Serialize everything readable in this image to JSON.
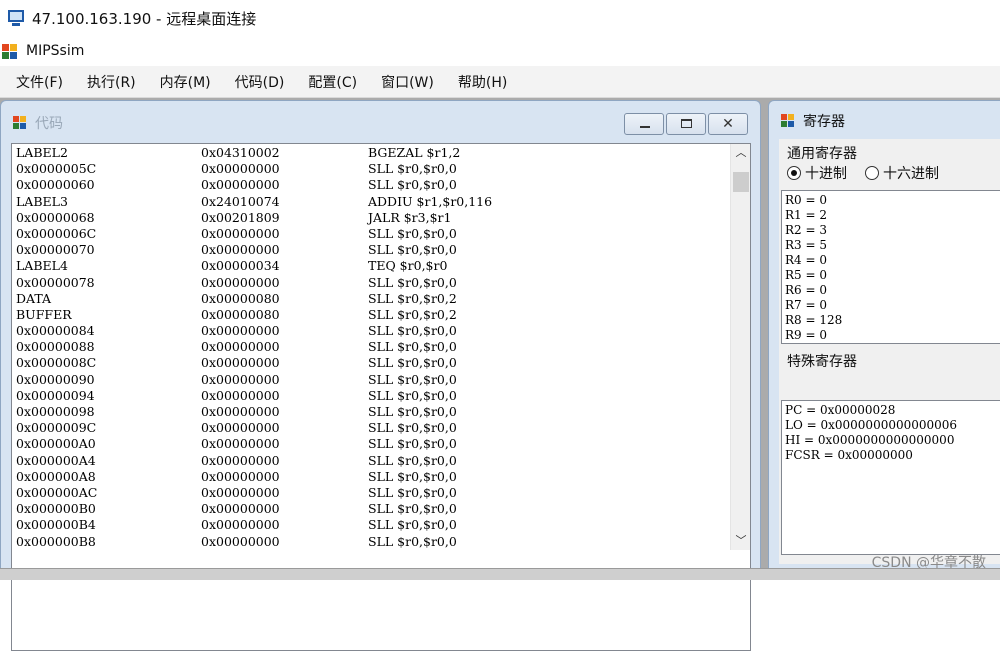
{
  "rdp": {
    "title": "47.100.163.190 - 远程桌面连接"
  },
  "app": {
    "title": "MIPSsim"
  },
  "menu": [
    "文件(F)",
    "执行(R)",
    "内存(M)",
    "代码(D)",
    "配置(C)",
    "窗口(W)",
    "帮助(H)"
  ],
  "code_window": {
    "title": "代码",
    "close_glyph": "✕",
    "rows": [
      [
        "LABEL2",
        "0x04310002",
        "BGEZAL $r1,2"
      ],
      [
        "0x0000005C",
        "0x00000000",
        "SLL $r0,$r0,0"
      ],
      [
        "0x00000060",
        "0x00000000",
        "SLL $r0,$r0,0"
      ],
      [
        "LABEL3",
        "0x24010074",
        "ADDIU $r1,$r0,116"
      ],
      [
        "0x00000068",
        "0x00201809",
        "JALR $r3,$r1"
      ],
      [
        "0x0000006C",
        "0x00000000",
        "SLL $r0,$r0,0"
      ],
      [
        "0x00000070",
        "0x00000000",
        "SLL $r0,$r0,0"
      ],
      [
        "LABEL4",
        "0x00000034",
        "TEQ $r0,$r0"
      ],
      [
        "0x00000078",
        "0x00000000",
        "SLL $r0,$r0,0"
      ],
      [
        "DATA",
        "0x00000080",
        "SLL $r0,$r0,2"
      ],
      [
        "BUFFER",
        "0x00000080",
        "SLL $r0,$r0,2"
      ],
      [
        "0x00000084",
        "0x00000000",
        "SLL $r0,$r0,0"
      ],
      [
        "0x00000088",
        "0x00000000",
        "SLL $r0,$r0,0"
      ],
      [
        "0x0000008C",
        "0x00000000",
        "SLL $r0,$r0,0"
      ],
      [
        "0x00000090",
        "0x00000000",
        "SLL $r0,$r0,0"
      ],
      [
        "0x00000094",
        "0x00000000",
        "SLL $r0,$r0,0"
      ],
      [
        "0x00000098",
        "0x00000000",
        "SLL $r0,$r0,0"
      ],
      [
        "0x0000009C",
        "0x00000000",
        "SLL $r0,$r0,0"
      ],
      [
        "0x000000A0",
        "0x00000000",
        "SLL $r0,$r0,0"
      ],
      [
        "0x000000A4",
        "0x00000000",
        "SLL $r0,$r0,0"
      ],
      [
        "0x000000A8",
        "0x00000000",
        "SLL $r0,$r0,0"
      ],
      [
        "0x000000AC",
        "0x00000000",
        "SLL $r0,$r0,0"
      ],
      [
        "0x000000B0",
        "0x00000000",
        "SLL $r0,$r0,0"
      ],
      [
        "0x000000B4",
        "0x00000000",
        "SLL $r0,$r0,0"
      ],
      [
        "0x000000B8",
        "0x00000000",
        "SLL $r0,$r0,0"
      ]
    ]
  },
  "register_window": {
    "title": "寄存器",
    "general_label": "通用寄存器",
    "radio_decimal": "十进制",
    "radio_hex": "十六进制",
    "general_registers": [
      "R0 = 0",
      "R1 = 2",
      "R2 = 3",
      "R3 = 5",
      "R4 = 0",
      "R5 = 0",
      "R6 = 0",
      "R7 = 0",
      "R8 = 128",
      "R9 = 0"
    ],
    "special_label": "特殊寄存器",
    "special_registers": [
      "PC = 0x00000028",
      "LO = 0x0000000000000006",
      "HI = 0x0000000000000000",
      "FCSR = 0x00000000"
    ]
  },
  "watermark": "CSDN @华章不散",
  "colors": {
    "window_frame": "#d8e4f2",
    "workspace": "#ababab",
    "menu_bg": "#f3f3f3"
  }
}
